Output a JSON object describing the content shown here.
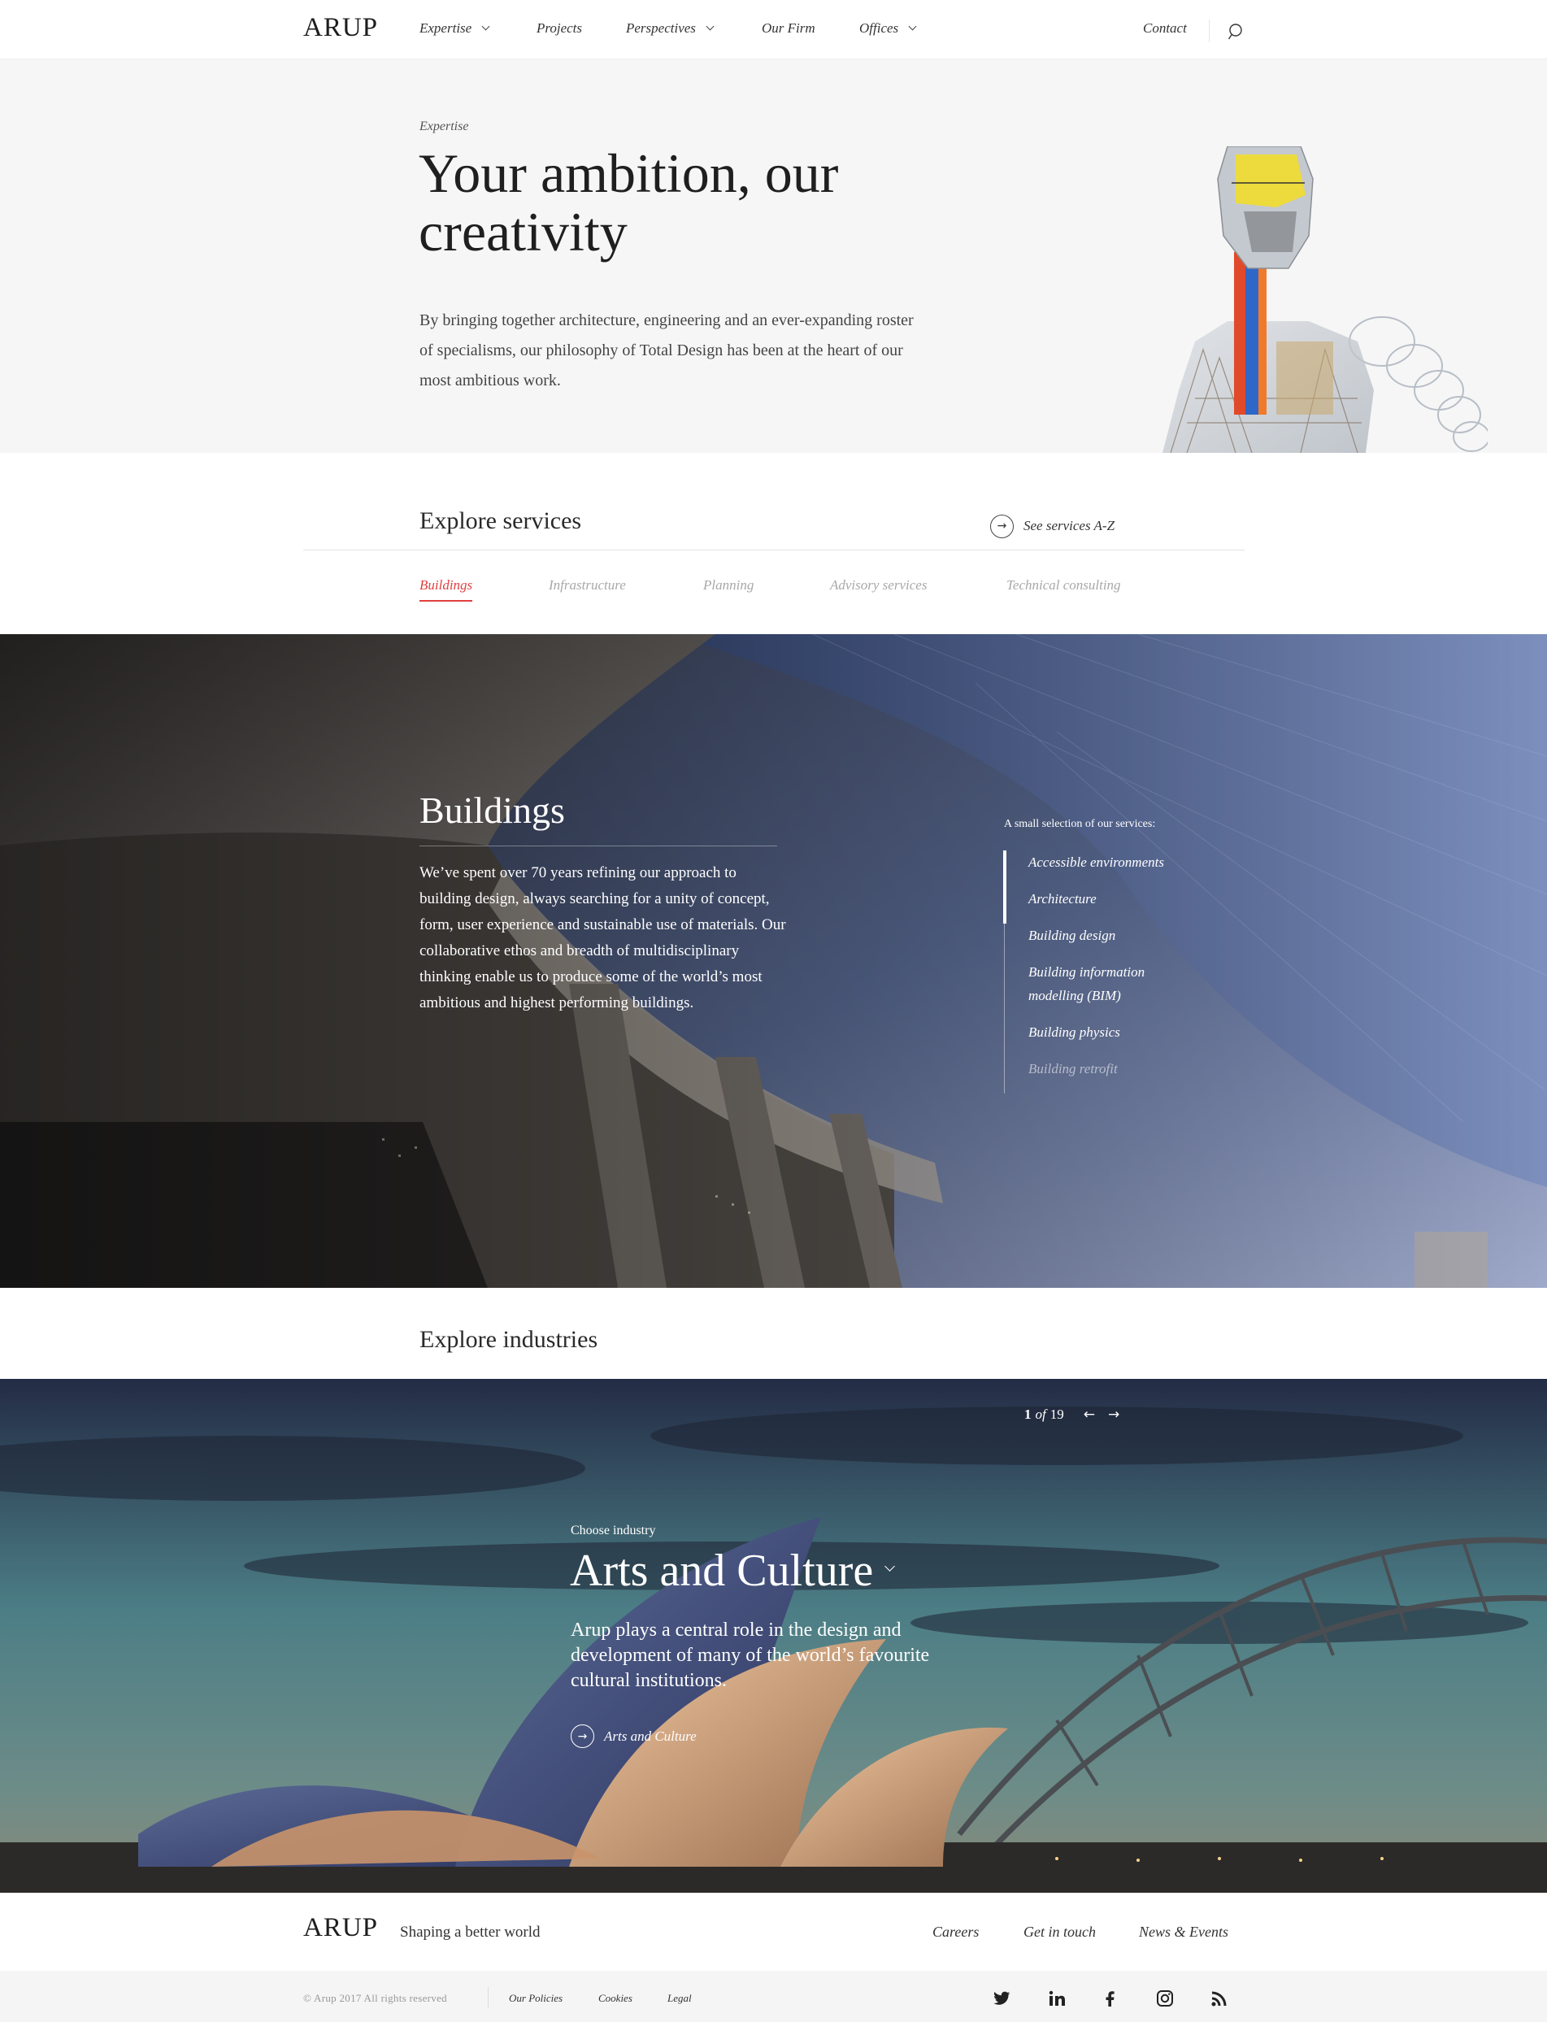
{
  "header": {
    "logo": "ARUP",
    "nav": [
      {
        "label": "Expertise",
        "has_menu": true
      },
      {
        "label": "Projects",
        "has_menu": false
      },
      {
        "label": "Perspectives",
        "has_menu": true
      },
      {
        "label": "Our Firm",
        "has_menu": false
      },
      {
        "label": "Offices",
        "has_menu": true
      }
    ],
    "contact_label": "Contact",
    "search_icon": "search-icon"
  },
  "hero": {
    "eyebrow": "Expertise",
    "title": "Your ambition, our creativity",
    "description": "By bringing together architecture, engineering and an ever-expanding roster of specialisms, our philosophy of Total Design has been at the heart of our most ambitious work."
  },
  "services": {
    "title": "Explore services",
    "az_link": "See services A-Z",
    "tabs": [
      "Buildings",
      "Infrastructure",
      "Planning",
      "Advisory services",
      "Technical consulting"
    ],
    "active_tab": "Buildings",
    "accent_color": "#e0403f"
  },
  "buildings": {
    "title": "Buildings",
    "description": "We’ve spent over 70 years refining our approach to building design, always searching for a unity of concept, form, user experience and sustainable use of materials. Our collaborative ethos and breadth of multidisciplinary thinking enable us to produce some of the world’s most ambitious and highest performing buildings.",
    "selection_label": "A small selection of our services:",
    "services_list": [
      "Accessible environments",
      "Architecture",
      "Building design",
      "Building information modelling (BIM)",
      "Building physics",
      "Building retrofit"
    ]
  },
  "industries": {
    "title": "Explore industries",
    "pager": {
      "current": "1",
      "of": "of",
      "total": "19"
    },
    "choose_label": "Choose industry",
    "industry_name": "Arts and Culture",
    "description": "Arup plays a central role in the design and development of many of the world’s favourite cultural institutions.",
    "link_label": "Arts and Culture"
  },
  "footer": {
    "logo": "ARUP",
    "tagline": "Shaping a better world",
    "links": [
      "Careers",
      "Get in touch",
      "News & Events"
    ],
    "copyright": "© Arup 2017 All rights reserved",
    "legal_links": [
      "Our Policies",
      "Cookies",
      "Legal"
    ],
    "social_icons": [
      "twitter-icon",
      "linkedin-icon",
      "facebook-icon",
      "instagram-icon",
      "rss-icon"
    ]
  }
}
